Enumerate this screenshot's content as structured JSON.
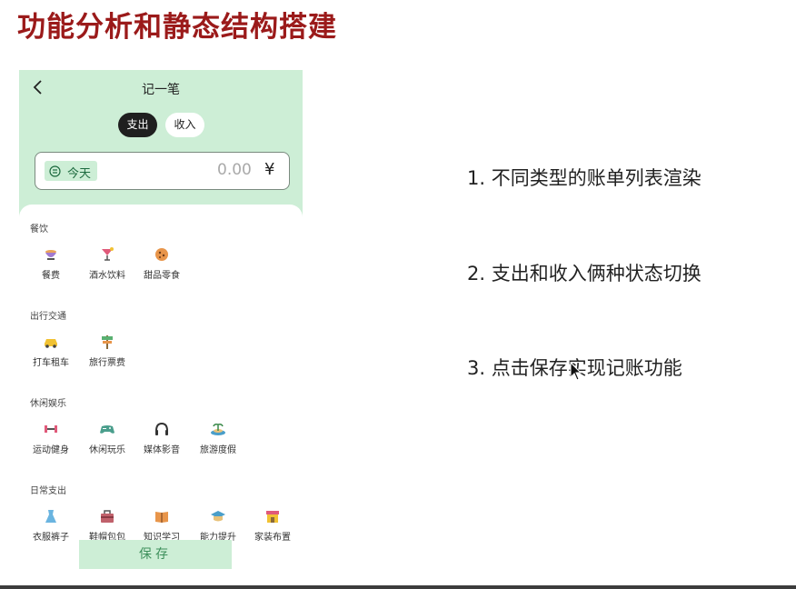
{
  "slide": {
    "title": "功能分析和静态结构搭建"
  },
  "phone": {
    "nav": {
      "back_icon": "chevron-left-icon",
      "title": "记一笔"
    },
    "tabs": [
      {
        "label": "支出",
        "active": true
      },
      {
        "label": "收入",
        "active": false
      }
    ],
    "entry": {
      "date_icon": "calendar-icon",
      "date_label": "今天",
      "amount": "0.00",
      "currency": "¥"
    },
    "sections": [
      {
        "title": "餐饮",
        "items": [
          {
            "label": "餐费",
            "icon": "bowl-icon"
          },
          {
            "label": "酒水饮料",
            "icon": "cocktail-icon"
          },
          {
            "label": "甜品零食",
            "icon": "cookie-icon"
          }
        ]
      },
      {
        "title": "出行交通",
        "items": [
          {
            "label": "打车租车",
            "icon": "car-icon"
          },
          {
            "label": "旅行票费",
            "icon": "signpost-icon"
          }
        ]
      },
      {
        "title": "休闲娱乐",
        "items": [
          {
            "label": "运动健身",
            "icon": "dumbbell-icon"
          },
          {
            "label": "休闲玩乐",
            "icon": "gamepad-icon"
          },
          {
            "label": "媒体影音",
            "icon": "headphones-icon"
          },
          {
            "label": "旅游度假",
            "icon": "island-icon"
          }
        ]
      },
      {
        "title": "日常支出",
        "items": [
          {
            "label": "衣服裤子",
            "icon": "dress-icon"
          },
          {
            "label": "鞋帽包包",
            "icon": "bag-icon"
          },
          {
            "label": "知识学习",
            "icon": "book-icon"
          },
          {
            "label": "能力提升",
            "icon": "graduation-cap-icon"
          },
          {
            "label": "家装布置",
            "icon": "storefront-icon"
          }
        ]
      }
    ],
    "save_label": "保存"
  },
  "points": [
    "1. 不同类型的账单列表渲染",
    "2. 支出和收入俩种状态切换",
    "3. 点击保存实现记账功能"
  ],
  "colors": {
    "title_red": "#9b1a1a",
    "mint": "#cdeed6",
    "dark_chip": "#1f1f1f",
    "save_text": "#3d8f5b"
  }
}
